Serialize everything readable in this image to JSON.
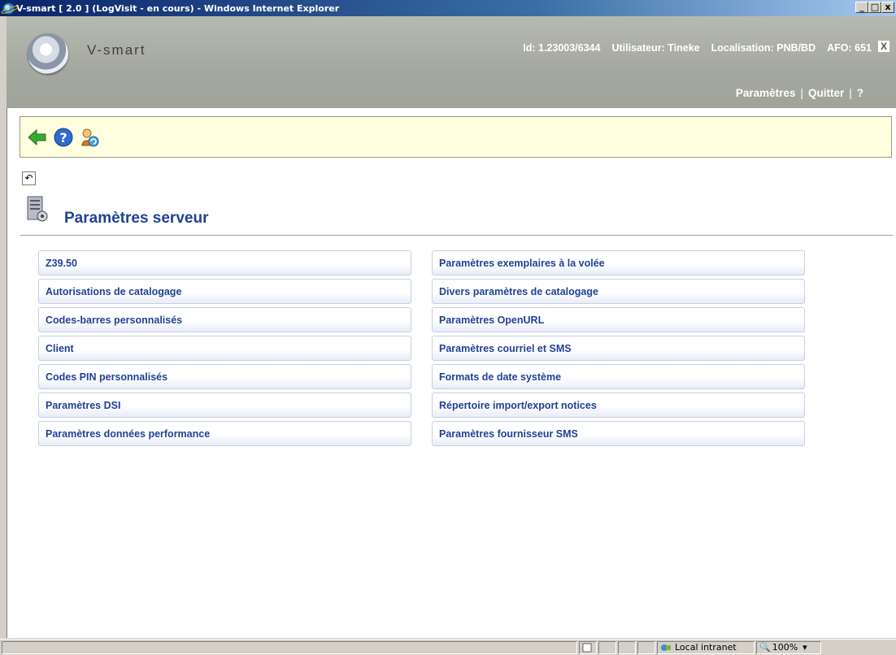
{
  "window": {
    "title": "V-smart [ 2.0 ] (LogVisit - en cours) - Windows Internet Explorer",
    "min": "_",
    "max": "□",
    "close": "x"
  },
  "header": {
    "logo_text": "V-smart",
    "id_text": "Id: 1.23003/6344",
    "user_text": "Utilisateur: Tineke",
    "location_text": "Localisation: PNB/BD",
    "afo_text": "AFO: 651",
    "close_label": "X",
    "links": {
      "params": "Paramètres",
      "quit": "Quitter",
      "help": "?"
    }
  },
  "page": {
    "title": "Paramètres serveur",
    "undo_glyph": "↶"
  },
  "menu": {
    "left": [
      "Z39.50",
      "Autorisations de catalogage",
      "Codes-barres personnalisés",
      "Client",
      "Codes PIN personnalisés",
      "Paramètres DSI",
      "Paramètres données performance"
    ],
    "right": [
      "Paramètres exemplaires à la volée",
      "Divers paramètres de catalogage",
      "Paramètres OpenURL",
      "Paramètres courriel et SMS",
      "Formats de date système",
      "Répertoire import/export notices",
      "Paramètres fournisseur SMS"
    ]
  },
  "status": {
    "zone": "Local intranet",
    "zoom": "100%"
  },
  "colors": {
    "accent": "#1f4196",
    "toolbar_bg": "#ffffe0"
  }
}
